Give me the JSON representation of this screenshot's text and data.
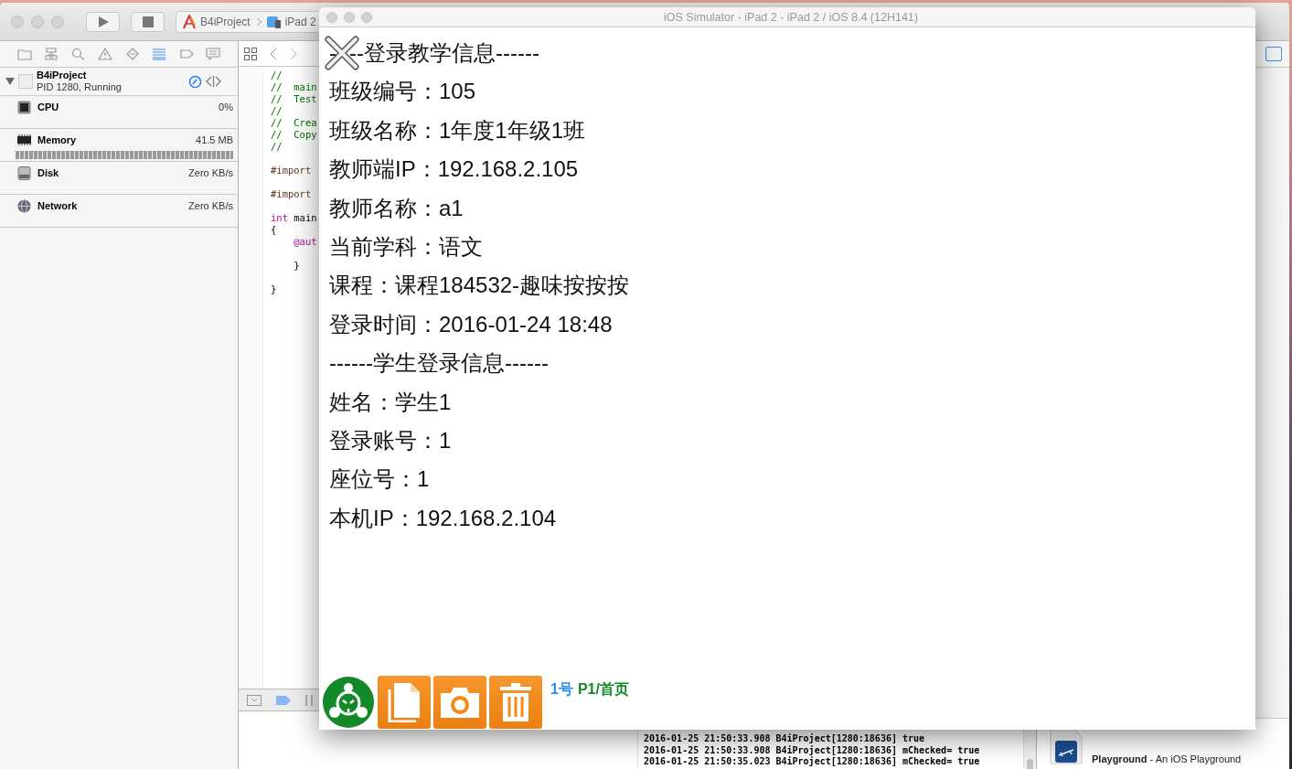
{
  "xcode": {
    "scheme": {
      "project": "B4iProject",
      "device": "iPad 2"
    },
    "navigator_tabs": [
      {
        "kind": "folder",
        "selected": false
      },
      {
        "kind": "hierarchy",
        "selected": false
      },
      {
        "kind": "search",
        "selected": false
      },
      {
        "kind": "warning",
        "selected": false
      },
      {
        "kind": "test",
        "selected": false
      },
      {
        "kind": "debug",
        "selected": true
      },
      {
        "kind": "breakpoint",
        "selected": false
      },
      {
        "kind": "report",
        "selected": false
      }
    ],
    "process": {
      "name": "B4iProject",
      "status": "PID 1280, Running",
      "expanded": true
    },
    "gauges": [
      {
        "kind": "cpu",
        "label": "CPU",
        "value": "0%"
      },
      {
        "kind": "memory",
        "label": "Memory",
        "value": "41.5 MB"
      },
      {
        "kind": "disk",
        "label": "Disk",
        "value": "Zero KB/s"
      },
      {
        "kind": "network",
        "label": "Network",
        "value": "Zero KB/s"
      }
    ],
    "code_blocks": [
      [
        {
          "tokens": [
            {
              "kind": "comment",
              "text": "//"
            }
          ]
        },
        {
          "tokens": [
            {
              "kind": "comment",
              "text": "//  main"
            }
          ]
        },
        {
          "tokens": [
            {
              "kind": "comment",
              "text": "//  Test"
            }
          ]
        },
        {
          "tokens": [
            {
              "kind": "comment",
              "text": "//"
            }
          ]
        },
        {
          "tokens": [
            {
              "kind": "comment",
              "text": "//  Crea"
            }
          ]
        },
        {
          "tokens": [
            {
              "kind": "comment",
              "text": "//  Copy"
            }
          ]
        },
        {
          "tokens": [
            {
              "kind": "comment",
              "text": "//"
            }
          ]
        }
      ],
      [
        {
          "tokens": [
            {
              "kind": "directive",
              "text": "#import"
            }
          ]
        }
      ],
      [
        {
          "tokens": [
            {
              "kind": "directive",
              "text": "#import"
            }
          ]
        }
      ],
      [
        {
          "tokens": [
            {
              "kind": "keyword",
              "text": "int"
            },
            {
              "kind": "plain",
              "text": " main"
            }
          ]
        },
        {
          "tokens": [
            {
              "kind": "plain",
              "text": "{"
            }
          ]
        },
        {
          "tokens": [
            {
              "kind": "keyword",
              "text": "    @aut"
            }
          ]
        }
      ],
      [
        {
          "tokens": [
            {
              "kind": "plain",
              "text": "    }"
            }
          ]
        }
      ],
      [
        {
          "tokens": [
            {
              "kind": "plain",
              "text": "}"
            }
          ]
        }
      ]
    ],
    "console": [
      "2016-01-25 21:50:33.908 B4iProject[1280:18636] true",
      "2016-01-25 21:50:33.908 B4iProject[1280:18636] mChecked= true",
      "2016-01-25 21:50:35.023 B4iProject[1280:18636] mChecked= true"
    ],
    "library_item": "**Playground** - An iOS Playground"
  },
  "simulator": {
    "title": "iOS Simulator - iPad 2 - iPad 2 / iOS 8.4 (12H141)",
    "heading_lead": "-",
    "heading_rest": "--登录教学信息------",
    "lines": [
      "班级编号：105",
      "班级名称：1年度1年级1班",
      "教师端IP：192.168.2.105",
      "教师名称：a1",
      "当前学科：语文",
      "课程：课程184532-趣味按按按",
      "登录时间：2016-01-24 18:48",
      "------学生登录信息------",
      "姓名：学生1",
      "登录账号：1",
      "座位号：1",
      "本机IP：192.168.2.104"
    ],
    "toolbar_buttons": [
      {
        "kind": "document"
      },
      {
        "kind": "camera"
      },
      {
        "kind": "trash"
      }
    ],
    "footer": {
      "number": "1号",
      "page": "P1/首页"
    }
  }
}
